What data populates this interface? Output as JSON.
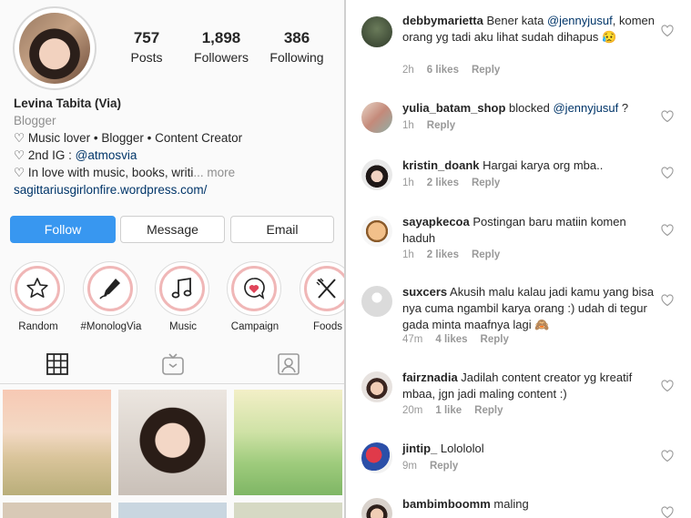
{
  "profile": {
    "stats": {
      "posts_num": "757",
      "posts_label": "Posts",
      "followers_num": "1,898",
      "followers_label": "Followers",
      "following_num": "386",
      "following_label": "Following"
    },
    "name": "Levina Tabita (Via)",
    "category": "Blogger",
    "bio_line1": "♡ Music lover • Blogger • Content Creator",
    "bio_line2_prefix": "♡ 2nd IG : ",
    "bio_line2_mention": "@atmosvia",
    "bio_line3": "♡ In love with music, books, writi",
    "bio_line3_more": "... more",
    "website": "sagittariusgirlonfire.wordpress.com/",
    "buttons": {
      "follow": "Follow",
      "message": "Message",
      "email": "Email"
    },
    "highlights": [
      {
        "label": "Random",
        "icon": "star-icon"
      },
      {
        "label": "#MonologVia",
        "icon": "pen-icon"
      },
      {
        "label": "Music",
        "icon": "music-note-icon"
      },
      {
        "label": "Campaign",
        "icon": "heart-bubble-icon"
      },
      {
        "label": "Foods",
        "icon": "fork-knife-icon"
      }
    ],
    "tabs": [
      "grid-icon",
      "igtv-icon",
      "tagged-icon"
    ]
  },
  "comments": [
    {
      "user": "debbymarietta",
      "text": " Bener kata ",
      "mention": "@jennyjusuf",
      "text2": ", komen orang yg tadi aku lihat sudah dihapus 😥",
      "time": "2h",
      "likes": "6 likes",
      "reply": "Reply"
    },
    {
      "user": "yulia_batam_shop",
      "text": " blocked ",
      "mention": "@jennyjusuf",
      "text2": " ?",
      "time": "1h",
      "likes": "",
      "reply": "Reply"
    },
    {
      "user": "kristin_doank",
      "text": " Hargai karya org mba..",
      "mention": "",
      "text2": "",
      "time": "1h",
      "likes": "2 likes",
      "reply": "Reply"
    },
    {
      "user": "sayapkecoa",
      "text": " Postingan baru matiin komen haduh",
      "mention": "",
      "text2": "",
      "time": "1h",
      "likes": "2 likes",
      "reply": "Reply"
    },
    {
      "user": "suxcers",
      "text": " Akusih malu kalau jadi kamu yang bisa nya cuma ngambil karya orang :) udah di tegur gada minta maafnya lagi 🙈",
      "mention": "",
      "text2": "",
      "time": "47m",
      "likes": "4 likes",
      "reply": "Reply"
    },
    {
      "user": "fairznadia",
      "text": " Jadilah content creator yg kreatif mbaa, jgn jadi maling content :)",
      "mention": "",
      "text2": "",
      "time": "20m",
      "likes": "1 like",
      "reply": "Reply"
    },
    {
      "user": "jintip_",
      "text": " Lolololol",
      "mention": "",
      "text2": "",
      "time": "9m",
      "likes": "",
      "reply": "Reply"
    },
    {
      "user": "bambimboomm",
      "text": " maling",
      "mention": "",
      "text2": "",
      "time": "",
      "likes": "",
      "reply": ""
    }
  ],
  "colors": {
    "accent": "#3897f0",
    "link": "#003569",
    "muted": "#8e8e8e"
  }
}
